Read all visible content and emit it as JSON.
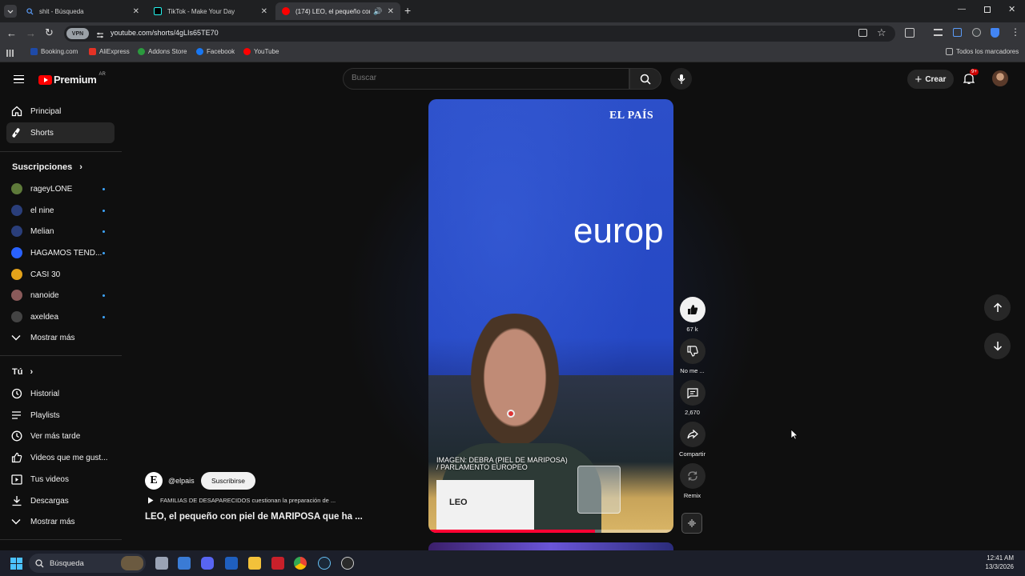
{
  "browser": {
    "tabs": [
      {
        "label": "shit - Búsqueda",
        "icon": "search-icon",
        "color": "#3b82f6"
      },
      {
        "label": "TikTok - Make Your Day",
        "icon": "tiktok-icon",
        "color": "#111111"
      },
      {
        "label": "(174) LEO, el pequeño con ...",
        "icon": "youtube-icon",
        "color": "#ff0000"
      }
    ],
    "url": "youtube.com/shorts/4gLIs65TE70",
    "vpn_label": "VPN",
    "bookmarks": [
      {
        "label": "Booking.com",
        "color": "#1e4aa8"
      },
      {
        "label": "AliExpress",
        "color": "#e43225"
      },
      {
        "label": "Addons Store",
        "color": "#2b9a3e"
      },
      {
        "label": "Facebook",
        "color": "#1877f2"
      },
      {
        "label": "YouTube",
        "color": "#ff0000"
      }
    ],
    "all_bookmarks": "Todos los marcadores",
    "notif_badge": "9+"
  },
  "youtube": {
    "logo": "Premium",
    "region": "AR",
    "search_placeholder": "Buscar",
    "create_label": "Crear",
    "sidebar": {
      "main": [
        {
          "label": "Principal",
          "icon": "home-icon"
        },
        {
          "label": "Shorts",
          "icon": "shorts-icon"
        }
      ],
      "subs_title": "Suscripciones",
      "subs": [
        {
          "label": "rageyLONE",
          "color": "#5e7a3a",
          "new": true
        },
        {
          "label": "el nine",
          "color": "#2a3e7a",
          "new": true
        },
        {
          "label": "Melian",
          "color": "#2a3e7a",
          "new": true
        },
        {
          "label": "HAGAMOS TEND...",
          "color": "#2962ff",
          "new": true
        },
        {
          "label": "CASI 30",
          "color": "#e3a21a",
          "new": false
        },
        {
          "label": "nanoide",
          "color": "#8a5a5a",
          "new": true
        },
        {
          "label": "axeldea",
          "color": "#444444",
          "new": true
        }
      ],
      "subs_more": "Mostrar más",
      "you_title": "Tú",
      "you": [
        {
          "label": "Historial",
          "icon": "history-icon"
        },
        {
          "label": "Playlists",
          "icon": "playlists-icon"
        },
        {
          "label": "Ver más tarde",
          "icon": "clock-icon"
        },
        {
          "label": "Videos que me gust...",
          "icon": "thumbs-up-icon"
        },
        {
          "label": "Tus videos",
          "icon": "video-icon"
        },
        {
          "label": "Descargas",
          "icon": "download-icon"
        }
      ],
      "you_more": "Mostrar más"
    },
    "short": {
      "watermark": "EL PAÍS",
      "big_text": "europ",
      "caption_line1": "IMAGEN: DEBRA (PIEL DE MARIPOSA)",
      "caption_line2": "/ PARLAMENTO EUROPEO",
      "name_card": "LEO",
      "progress": 0.68
    },
    "channel": {
      "handle": "@elpais",
      "initial": "E",
      "subscribe": "Suscribirse",
      "playlist_line": "FAMILIAS DE DESAPARECIDOS cuestionan la preparación de ...",
      "title": "LEO, el pequeño con piel de MARIPOSA que ha ..."
    },
    "actions": {
      "likes": "67 k",
      "dislike": "No me ...",
      "comments": "2,670",
      "share": "Compartir",
      "remix": "Remix"
    }
  },
  "taskbar": {
    "search": "Búsqueda",
    "time": "12:41 AM",
    "date": "13/3/2026"
  }
}
